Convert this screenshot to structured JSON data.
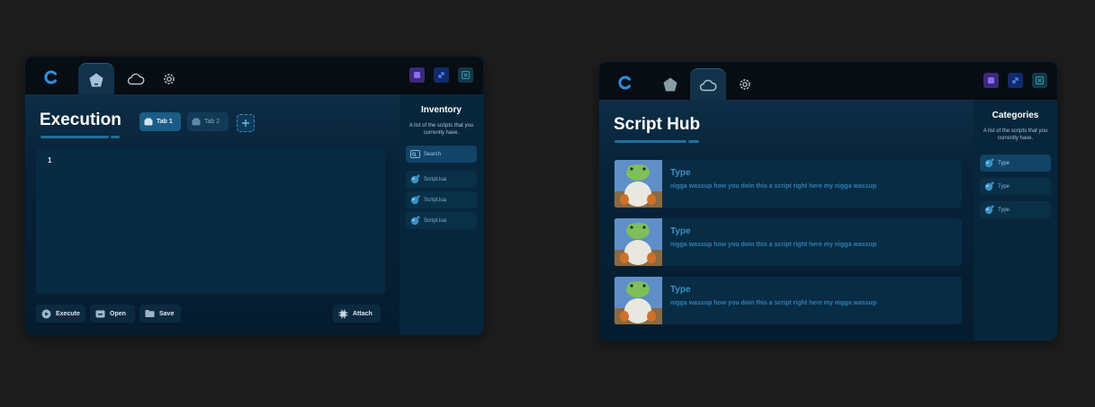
{
  "colors": {
    "accent": "#1e6f9c",
    "background": "#1d1d1d",
    "window": "#07121b",
    "panel": "#07263b"
  },
  "execution_window": {
    "logo_icon": "c-logo-icon",
    "tabs": [
      {
        "icon": "home-icon",
        "active": true
      },
      {
        "icon": "cloud-icon",
        "active": false
      },
      {
        "icon": "gear-icon",
        "active": false
      }
    ],
    "window_controls": [
      "minimize-icon",
      "maximize-icon",
      "close-icon"
    ],
    "title": "Execution",
    "editor_tabs": [
      {
        "label": "Tab 1",
        "active": true
      },
      {
        "label": "Tab 2",
        "active": false
      }
    ],
    "add_tab_icon": "plus-icon",
    "editor": {
      "line_numbers": [
        "1"
      ]
    },
    "buttons": {
      "execute": "Execute",
      "open": "Open",
      "save": "Save",
      "attach": "Attach"
    },
    "sidebar": {
      "title": "Inventory",
      "subtitle": "A list of the scripts that you currently have.",
      "search_label": "Search",
      "items": [
        "Script.lua",
        "Script.lua",
        "Script.lua"
      ]
    }
  },
  "hub_window": {
    "logo_icon": "c-logo-icon",
    "tabs": [
      {
        "icon": "home-icon",
        "active": false
      },
      {
        "icon": "cloud-icon",
        "active": true
      },
      {
        "icon": "gear-icon",
        "active": false
      }
    ],
    "title": "Script Hub",
    "cards": [
      {
        "title": "Type",
        "description": "nigga wassup how you doin this a script right here my nigga wassup"
      },
      {
        "title": "Type",
        "description": "nigga wassup how you doin this a script right here my nigga wassup"
      },
      {
        "title": "Type",
        "description": "nigga wassup how you doin this a script right here my nigga wassup"
      }
    ],
    "sidebar": {
      "title": "Categories",
      "subtitle": "A list of the scripts that you currently have.",
      "items": [
        "Type",
        "Type",
        "Type"
      ]
    }
  }
}
